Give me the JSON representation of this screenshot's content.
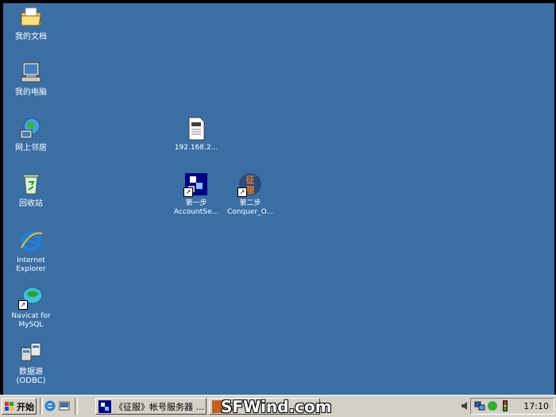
{
  "desktop_icons": {
    "my_documents": "我的文档",
    "my_computer": "我的电脑",
    "network_places": "网上邻居",
    "recycle_bin": "回收站",
    "internet_explorer": "Internet\nExplorer",
    "navicat": "Navicat for\nMySQL",
    "odbc": "数据源\n(ODBC)",
    "file_192": "192.168.2...",
    "step1": "第一步\nAccountSe...",
    "step2": "第二步\nConquer_O..."
  },
  "taskbar": {
    "start_label": "开始",
    "task1": "《征服》帐号服务器 ...",
    "task2": "征",
    "clock": "17:10"
  },
  "watermark": "SFWind.com",
  "icons": {
    "start": "windows-flag-icon",
    "ie": "internet-explorer-icon",
    "desktop": "show-desktop-icon"
  }
}
